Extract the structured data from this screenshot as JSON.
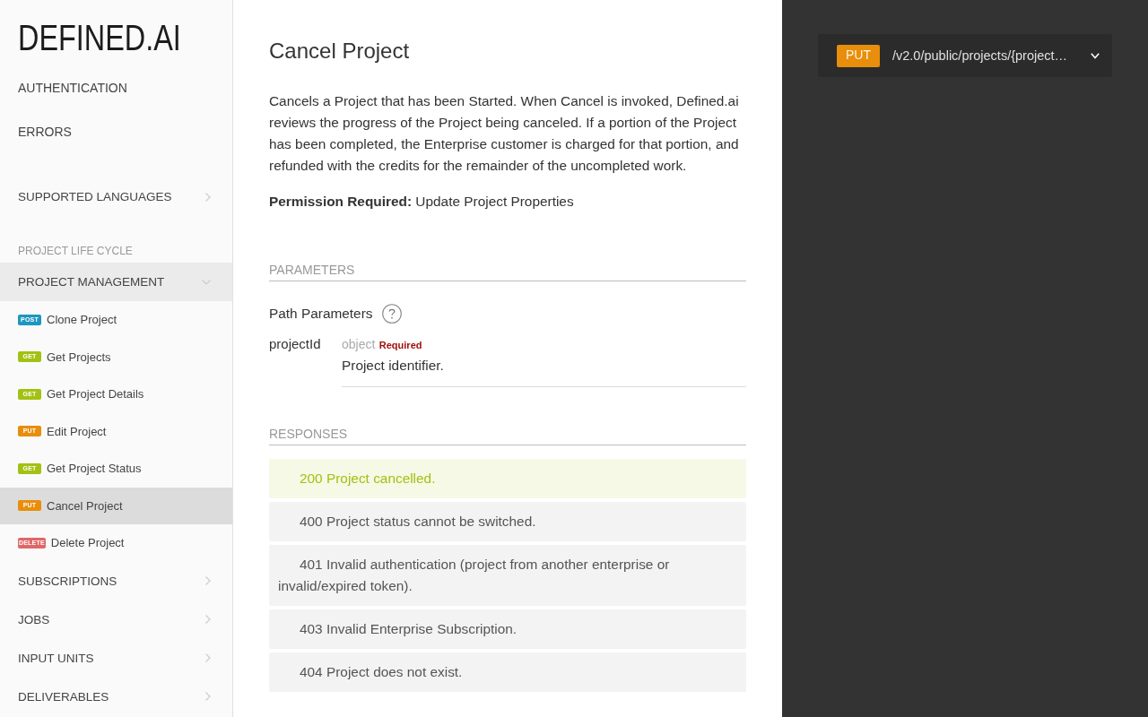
{
  "logo": {
    "text": "DEFINED.AI"
  },
  "sidebar": {
    "items": [
      {
        "kind": "link",
        "label": "AUTHENTICATION"
      },
      {
        "kind": "link",
        "label": "ERRORS"
      },
      {
        "kind": "group",
        "label": "SUPPORTED LANGUAGES",
        "expanded": false
      },
      {
        "kind": "heading",
        "label": "PROJECT LIFE CYCLE"
      },
      {
        "kind": "group",
        "label": "PROJECT MANAGEMENT",
        "expanded": true,
        "children": [
          {
            "method": "POST",
            "color": "#1d97bf",
            "label": "Clone Project",
            "selected": false
          },
          {
            "method": "GET",
            "color": "#a2c112",
            "label": "Get Projects",
            "selected": false
          },
          {
            "method": "GET",
            "color": "#a2c112",
            "label": "Get Project Details",
            "selected": false
          },
          {
            "method": "PUT",
            "color": "#e88e0c",
            "label": "Edit Project",
            "selected": false
          },
          {
            "method": "GET",
            "color": "#a2c112",
            "label": "Get Project Status",
            "selected": false
          },
          {
            "method": "PUT",
            "color": "#e88e0c",
            "label": "Cancel Project",
            "selected": true
          },
          {
            "method": "DELETE",
            "color": "#e06666",
            "label": "Delete Project",
            "selected": false
          }
        ]
      },
      {
        "kind": "group",
        "label": "SUBSCRIPTIONS",
        "expanded": false
      },
      {
        "kind": "group",
        "label": "JOBS",
        "expanded": false
      },
      {
        "kind": "group",
        "label": "INPUT UNITS",
        "expanded": false
      },
      {
        "kind": "group",
        "label": "DELIVERABLES",
        "expanded": false
      }
    ]
  },
  "page": {
    "title": "Cancel Project",
    "description": "Cancels a Project that has been Started. When Cancel is invoked, Defined.ai reviews the progress of the Project being canceled. If a portion of the Project has been completed, the Enterprise customer is charged for that portion, and refunded with the credits for the remainder of the uncompleted work.",
    "permission": "**Permission Required:** Update Project Properties"
  },
  "parameters": {
    "heading": "PARAMETERS",
    "groups": [
      {
        "title": "Path Parameters",
        "params": [
          {
            "name": "projectId",
            "type": "object",
            "required_label": "Required",
            "description": "Project identifier."
          }
        ]
      }
    ]
  },
  "responses": {
    "heading": "RESPONSES",
    "items": [
      {
        "kind": "success",
        "text": "200 Project cancelled."
      },
      {
        "kind": "error",
        "text": "400 Project status cannot be switched."
      },
      {
        "kind": "error",
        "text": "401 Invalid authentication (project from another enterprise or invalid/expired token)."
      },
      {
        "kind": "error",
        "text": "403 Invalid Enterprise Subscription."
      },
      {
        "kind": "error",
        "text": "404 Project does not exist."
      }
    ]
  },
  "endpoint": {
    "method": "PUT",
    "color": "#e88e0c",
    "path": "/v2.0/public/projects/{project…"
  }
}
